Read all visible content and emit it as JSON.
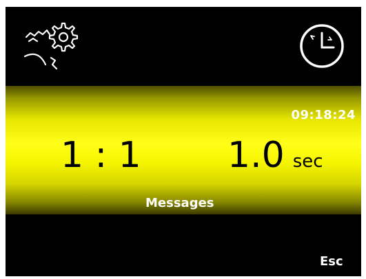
{
  "icons": {
    "settings": "gears-icon",
    "clock": "clock-icon"
  },
  "status": {
    "time": "09:18:24"
  },
  "display": {
    "ratio": "1 : 1",
    "duration_value": "1.0",
    "duration_unit": "sec"
  },
  "actions": {
    "messages_label": "Messages",
    "esc_label": "Esc"
  },
  "colors": {
    "background": "#000000",
    "band_highlight": "#ffff1a",
    "text_light": "#ffffff",
    "text_dark": "#000000"
  }
}
